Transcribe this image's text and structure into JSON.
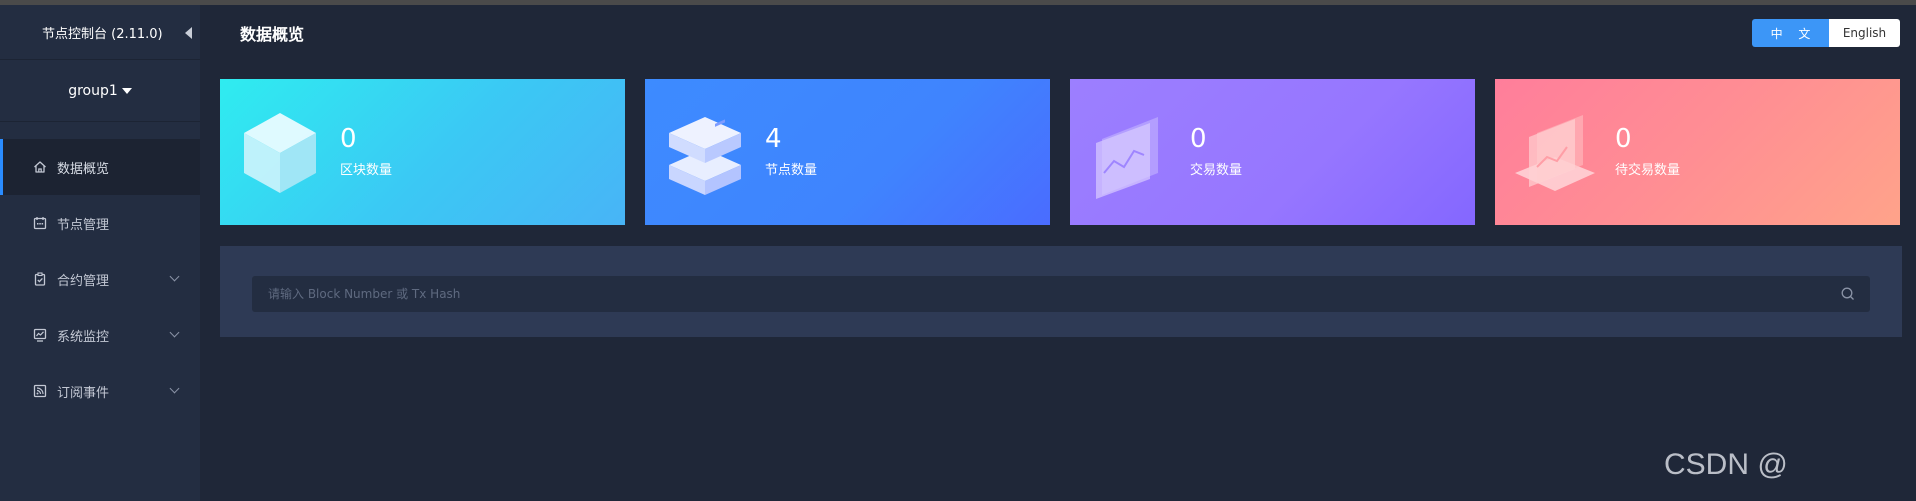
{
  "app": {
    "title": "节点控制台 (2.11.0)",
    "group": "group1"
  },
  "sidebar": {
    "items": [
      {
        "label": "数据概览",
        "icon": "home-icon",
        "active": true,
        "has_children": false
      },
      {
        "label": "节点管理",
        "icon": "calendar-icon",
        "active": false,
        "has_children": false
      },
      {
        "label": "合约管理",
        "icon": "clipboard-check-icon",
        "active": false,
        "has_children": true
      },
      {
        "label": "系统监控",
        "icon": "monitor-chart-icon",
        "active": false,
        "has_children": true
      },
      {
        "label": "订阅事件",
        "icon": "rss-icon",
        "active": false,
        "has_children": true
      }
    ]
  },
  "header": {
    "title": "数据概览",
    "lang_zh": "中 文",
    "lang_en": "English",
    "active_lang": "zh"
  },
  "cards": [
    {
      "value": "0",
      "label": "区块数量",
      "icon": "cube-icon"
    },
    {
      "value": "4",
      "label": "节点数量",
      "icon": "server-stack-icon"
    },
    {
      "value": "0",
      "label": "交易数量",
      "icon": "transaction-chart-icon"
    },
    {
      "value": "0",
      "label": "待交易数量",
      "icon": "pending-transaction-icon"
    }
  ],
  "search": {
    "placeholder": "请输入 Block Number 或 Tx Hash",
    "value": ""
  },
  "watermark": "CSDN @",
  "colors": {
    "background": "#1f2738",
    "sidebar": "#232d41",
    "accent": "#2a8cff",
    "card_cyan": "#2fecf0",
    "card_blue": "#3d8bff",
    "card_purple": "#9c7fff",
    "card_pink": "#ff7e9b"
  }
}
